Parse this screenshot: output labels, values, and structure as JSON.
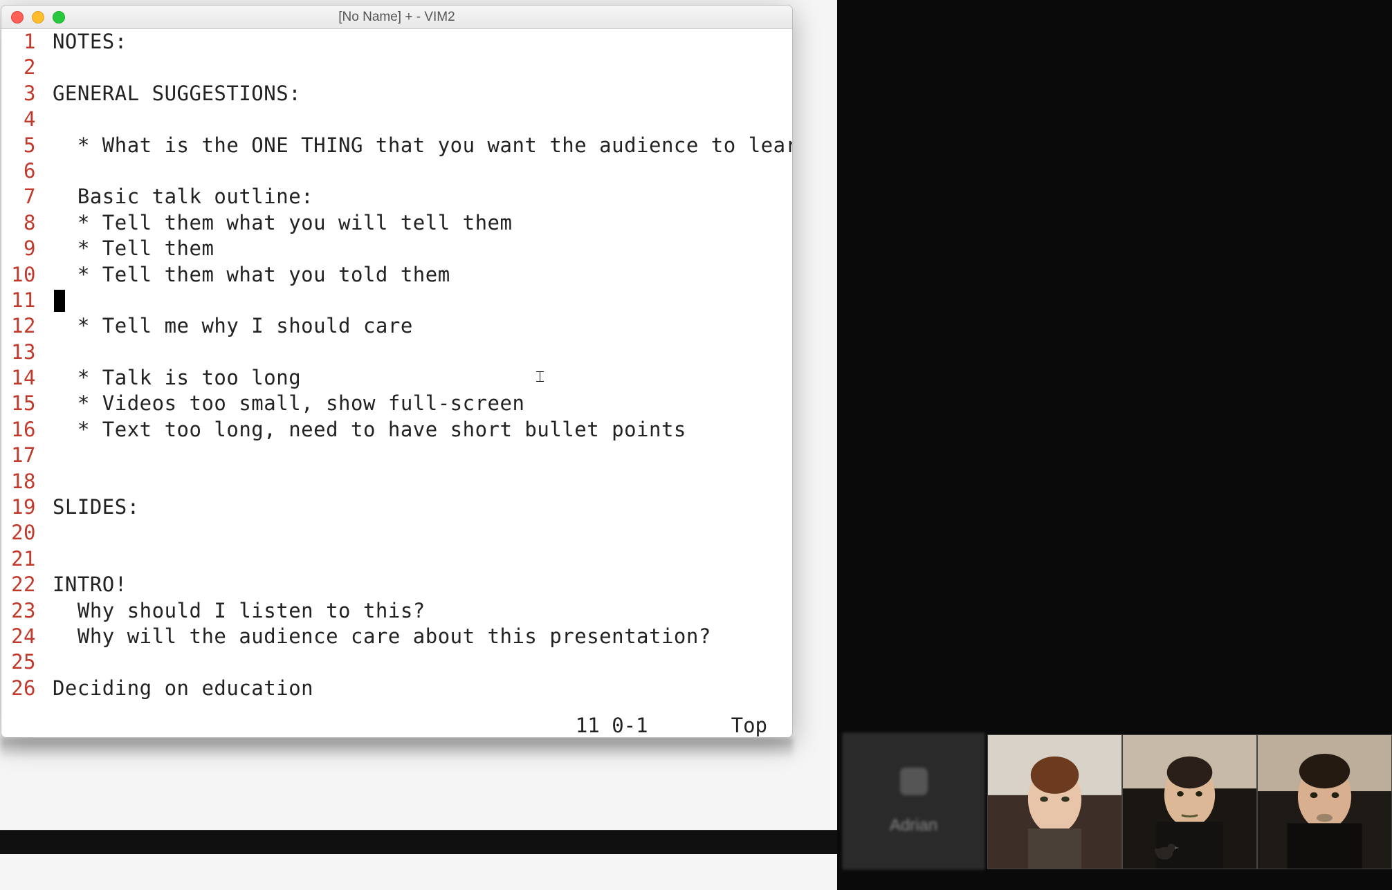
{
  "window": {
    "title": "[No Name] + - VIM2"
  },
  "status": {
    "position": "11 0-1",
    "scroll": "Top"
  },
  "participants": {
    "blurred_label": "Adrian"
  },
  "lines": [
    {
      "n": "1",
      "text": "NOTES:"
    },
    {
      "n": "2",
      "text": ""
    },
    {
      "n": "3",
      "text": "GENERAL SUGGESTIONS:"
    },
    {
      "n": "4",
      "text": ""
    },
    {
      "n": "5",
      "text": "  * What is the ONE THING that you want the audience to learn?"
    },
    {
      "n": "6",
      "text": ""
    },
    {
      "n": "7",
      "text": "  Basic talk outline:"
    },
    {
      "n": "8",
      "text": "  * Tell them what you will tell them"
    },
    {
      "n": "9",
      "text": "  * Tell them"
    },
    {
      "n": "10",
      "text": "  * Tell them what you told them"
    },
    {
      "n": "11",
      "text": "",
      "cursor": true
    },
    {
      "n": "12",
      "text": "  * Tell me why I should care"
    },
    {
      "n": "13",
      "text": ""
    },
    {
      "n": "14",
      "text": "  * Talk is too long"
    },
    {
      "n": "15",
      "text": "  * Videos too small, show full-screen"
    },
    {
      "n": "16",
      "text": "  * Text too long, need to have short bullet points"
    },
    {
      "n": "17",
      "text": ""
    },
    {
      "n": "18",
      "text": ""
    },
    {
      "n": "19",
      "text": "SLIDES:"
    },
    {
      "n": "20",
      "text": ""
    },
    {
      "n": "21",
      "text": ""
    },
    {
      "n": "22",
      "text": "INTRO!"
    },
    {
      "n": "23",
      "text": "  Why should I listen to this?"
    },
    {
      "n": "24",
      "text": "  Why will the audience care about this presentation?"
    },
    {
      "n": "25",
      "text": ""
    },
    {
      "n": "26",
      "text": "Deciding on education"
    }
  ]
}
